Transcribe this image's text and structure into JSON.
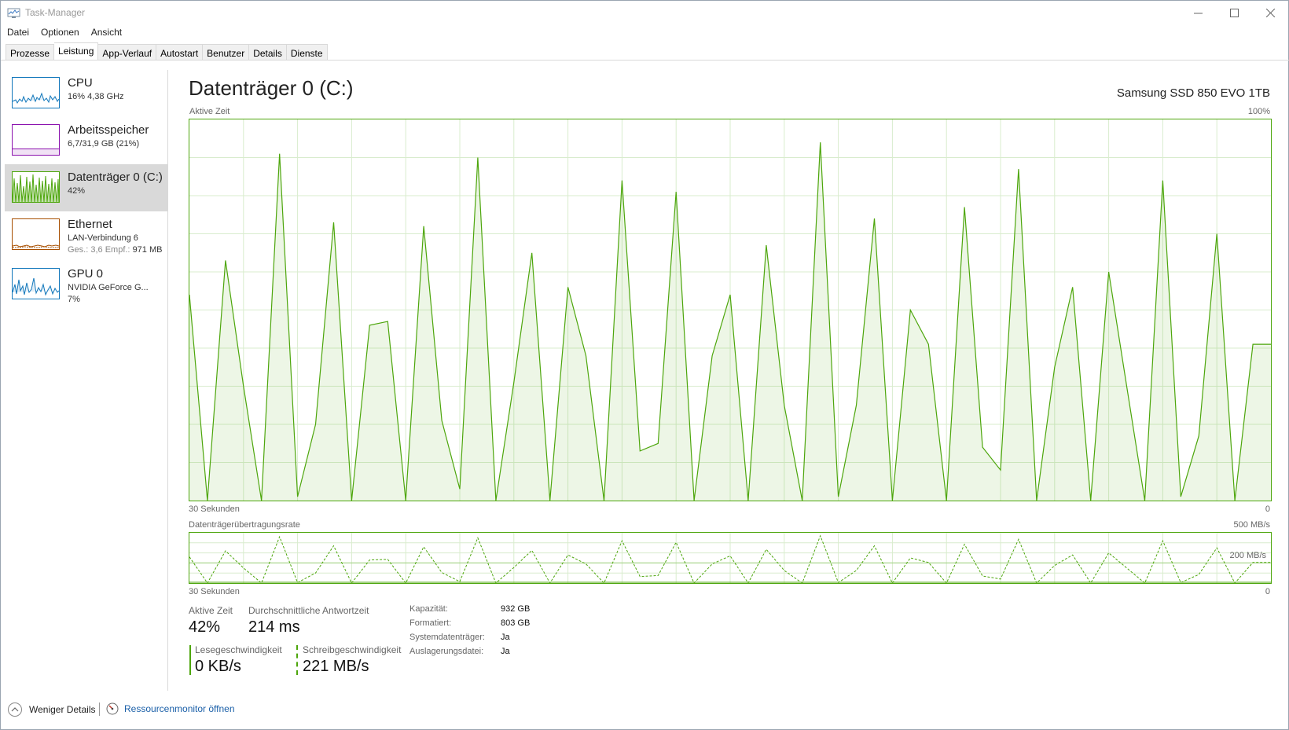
{
  "window": {
    "title": "Task-Manager"
  },
  "menu": [
    "Datei",
    "Optionen",
    "Ansicht"
  ],
  "tabs": [
    "Prozesse",
    "Leistung",
    "App-Verlauf",
    "Autostart",
    "Benutzer",
    "Details",
    "Dienste"
  ],
  "active_tab": "Leistung",
  "sidebar": [
    {
      "name": "CPU",
      "line1": "16%  4,38 GHz",
      "color": "#1177bb"
    },
    {
      "name": "Arbeitsspeicher",
      "line1": "6,7/31,9 GB (21%)",
      "color": "#8b12ae",
      "value_percent": 21
    },
    {
      "name": "Datenträger 0 (C:)",
      "line1": "42%",
      "color": "#4da60c",
      "selected": true
    },
    {
      "name": "Ethernet",
      "line1": "LAN-Verbindung 6",
      "line2_key": "Ges.: 3,6",
      "line2_key2": "Empf.:",
      "line2_val": "971 MB",
      "color": "#a74f01"
    },
    {
      "name": "GPU 0",
      "line1": "NVIDIA GeForce G...",
      "line2": "7%",
      "color": "#1177bb"
    }
  ],
  "main": {
    "title": "Datenträger 0 (C:)",
    "device": "Samsung SSD 850 EVO 1TB",
    "graph1": {
      "label": "Aktive Zeit",
      "max_label": "100%",
      "time_label": "30 Sekunden",
      "min_label": "0"
    },
    "graph2": {
      "label": "Datenträgerübertragungsrate",
      "max_label": "500 MB/s",
      "mid_label": "200 MB/s",
      "time_label": "30 Sekunden",
      "min_label": "0"
    },
    "stats": {
      "active_time_label": "Aktive Zeit",
      "active_time_value": "42%",
      "response_label": "Durchschnittliche Antwortzeit",
      "response_value": "214 ms",
      "read_label": "Lesegeschwindigkeit",
      "read_value": "0 KB/s",
      "write_label": "Schreibgeschwindigkeit",
      "write_value": "221 MB/s"
    },
    "info": [
      {
        "key": "Kapazität:",
        "value": "932 GB"
      },
      {
        "key": "Formatiert:",
        "value": "803 GB"
      },
      {
        "key": "Systemdatenträger:",
        "value": "Ja"
      },
      {
        "key": "Auslagerungsdatei:",
        "value": "Ja"
      }
    ]
  },
  "footer": {
    "less_details": "Weniger Details",
    "resource_monitor": "Ressourcenmonitor öffnen"
  },
  "chart_data": [
    {
      "type": "area",
      "title": "Aktive Zeit",
      "ylim": [
        0,
        100
      ],
      "x": [
        0,
        0.5,
        1,
        1.5,
        2,
        2.5,
        3,
        3.5,
        4,
        4.5,
        5,
        5.5,
        6,
        6.5,
        7,
        7.5,
        8,
        8.5,
        9,
        9.5,
        10,
        10.5,
        11,
        11.5,
        12,
        12.5,
        13,
        13.5,
        14,
        14.5,
        15,
        15.5,
        16,
        16.5,
        17,
        17.5,
        18,
        18.5,
        19,
        19.5,
        20,
        20.5,
        21,
        21.5,
        22,
        22.5,
        23,
        23.5,
        24,
        24.5,
        25,
        25.5,
        26,
        26.5,
        27,
        27.5,
        28,
        28.5,
        29,
        29.5,
        30
      ],
      "series": [
        {
          "values": [
            54,
            0,
            63,
            30,
            0,
            91,
            1,
            20,
            73,
            0,
            46,
            47,
            0,
            72,
            21,
            3,
            90,
            0,
            31,
            65,
            0,
            56,
            38,
            0,
            84,
            13,
            15,
            81,
            0,
            38,
            54,
            0,
            67,
            25,
            0,
            94,
            1,
            25,
            74,
            0,
            50,
            41,
            0,
            77,
            14,
            8,
            87,
            0,
            35,
            56,
            0,
            60,
            30,
            0,
            84,
            1,
            17,
            70,
            0,
            41,
            41
          ]
        }
      ]
    },
    {
      "type": "line",
      "title": "Datenträgerübertragungsrate",
      "ylim": [
        0,
        500
      ],
      "x": [
        0,
        0.5,
        1,
        1.5,
        2,
        2.5,
        3,
        3.5,
        4,
        4.5,
        5,
        5.5,
        6,
        6.5,
        7,
        7.5,
        8,
        8.5,
        9,
        9.5,
        10,
        10.5,
        11,
        11.5,
        12,
        12.5,
        13,
        13.5,
        14,
        14.5,
        15,
        15.5,
        16,
        16.5,
        17,
        17.5,
        18,
        18.5,
        19,
        19.5,
        20,
        20.5,
        21,
        21.5,
        22,
        22.5,
        23,
        23.5,
        24,
        24.5,
        25,
        25.5,
        26,
        26.5,
        27,
        27.5,
        28,
        28.5,
        29,
        29.5,
        30
      ],
      "series": [
        {
          "name": "Lesegeschwindigkeit",
          "values": [
            0,
            0,
            0,
            0,
            0,
            0,
            0,
            0,
            0,
            0,
            0,
            0,
            0,
            0,
            0,
            0,
            0,
            0,
            0,
            0,
            0,
            0,
            0,
            0,
            0,
            0,
            0,
            0,
            0,
            0,
            0,
            0,
            0,
            0,
            0,
            0,
            0,
            0,
            0,
            0,
            0,
            0,
            0,
            0,
            0,
            0,
            0,
            0,
            0,
            0,
            0,
            0,
            0,
            0,
            0,
            0,
            0,
            0,
            0,
            0,
            0
          ]
        },
        {
          "name": "Schreibgeschwindigkeit",
          "values": [
            260,
            0,
            320,
            150,
            0,
            460,
            5,
            100,
            370,
            0,
            230,
            235,
            0,
            360,
            105,
            15,
            450,
            0,
            155,
            325,
            0,
            280,
            190,
            0,
            420,
            65,
            75,
            405,
            0,
            190,
            270,
            0,
            335,
            125,
            0,
            470,
            5,
            125,
            370,
            0,
            250,
            205,
            0,
            385,
            70,
            40,
            435,
            0,
            175,
            280,
            0,
            300,
            150,
            0,
            420,
            5,
            85,
            350,
            0,
            205,
            205
          ]
        }
      ]
    }
  ]
}
